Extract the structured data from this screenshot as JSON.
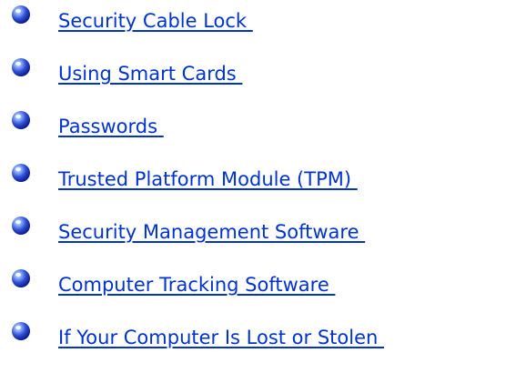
{
  "bullet_icon": "blue-sphere-bullet-icon",
  "colors": {
    "link": "#0033cc",
    "bullet_dark": "#0a1a8c",
    "bullet_light": "#9ec0ff"
  },
  "links": [
    {
      "label": "Security Cable Lock "
    },
    {
      "label": "Using Smart Cards "
    },
    {
      "label": "Passwords "
    },
    {
      "label": "Trusted Platform Module (TPM) "
    },
    {
      "label": "Security Management Software "
    },
    {
      "label": "Computer Tracking Software "
    },
    {
      "label": "If Your Computer Is Lost or Stolen "
    }
  ]
}
